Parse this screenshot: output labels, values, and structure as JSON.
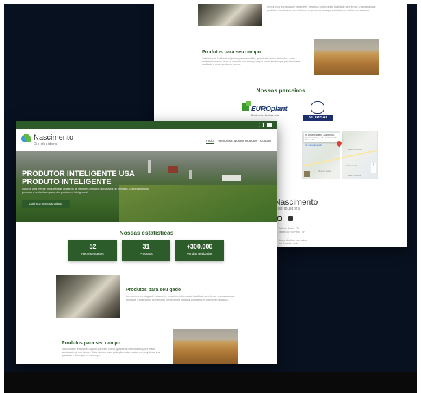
{
  "back": {
    "cattle_text": "Com a nova tecnologia de transportes, rebanhos podem a alta localidade para formar a pecuária mais produtiva. Combinamos os melhores componentes para que você atinja os melhores resultados.",
    "field_title": "Produtos para seu campo",
    "field_text": "Toda linha de fertilizantes líquidos para seu cultivo, garantindo melhor absorção e maior rendimento em sua lavoura. Além de uma maior proteção contra insetos que prejudicam sua qualidade e desempenho no campo.",
    "partners_title": "Nossos parceiros",
    "partner1_name": "EUROplant",
    "partner1_tagline": "Plante mais. Produza mais",
    "partner2_name": "NUTRISAL",
    "map_place": "R. Antônio Bueno - Jardim do...",
    "map_address": "R. Antônio Bueno, 75 - Jardim do São Paulo - SP",
    "map_link": "Ver mapa ampliado",
    "map_label1": "Jardim Rio Preto",
    "map_label2": "Jardim Canaã",
    "map_label3": "Vila Bom Jesus",
    "map_label4": "Jardim Antunes",
    "footer_brand": "Nascimento",
    "footer_sub": "Distribuidora",
    "footer_addr1": "Antônio Bueno - 75",
    "footer_addr2": "Jardim do Rio Preto - SP",
    "footer_copy": "dos os direitos reservados",
    "footer_dev": "por Samuel Lourel"
  },
  "front": {
    "brand": "Nascimento",
    "brand_sub": "Distribuidora",
    "nav": [
      "Início",
      "A empresa",
      "Nossos produtos",
      "Contato"
    ],
    "hero_title_1": "PRODUTOR INTELIGENTE USA",
    "hero_title_2": "PRODUTO INTELIGENTE",
    "hero_text": "Garanta uma melhor produtividade utilizando as melhores produtos disponíveis no mercado. Conheça nossos produtos e venha fazer parte dos produtores inteligentes!",
    "hero_button": "Conheça nossos produtos",
    "stats_title": "Nossas estatísticas",
    "stats": [
      {
        "value": "52",
        "label": "Representantes"
      },
      {
        "value": "31",
        "label": "Produtos"
      },
      {
        "value": "+300.000",
        "label": "Vendas realizadas"
      }
    ],
    "cattle_title": "Produtos para seu gado",
    "cattle_text": "Com a nova tecnologia de transportes, rebanhos podem a alta localidade para formar a pecuária mais produtiva. Combinamos os melhores componentes para que você atinja os melhores resultados.",
    "field_title": "Produtos para seu campo",
    "field_text": "Toda linha de fertilizantes líquidos para seu cultivo, garantindo melhor absorção e maior rendimento em sua lavoura. Além de uma maior proteção contra insetos que prejudicam sua qualidade e desempenho no campo."
  },
  "colors": {
    "brand_green": "#2c5a29",
    "frame_bg": "#081120"
  }
}
